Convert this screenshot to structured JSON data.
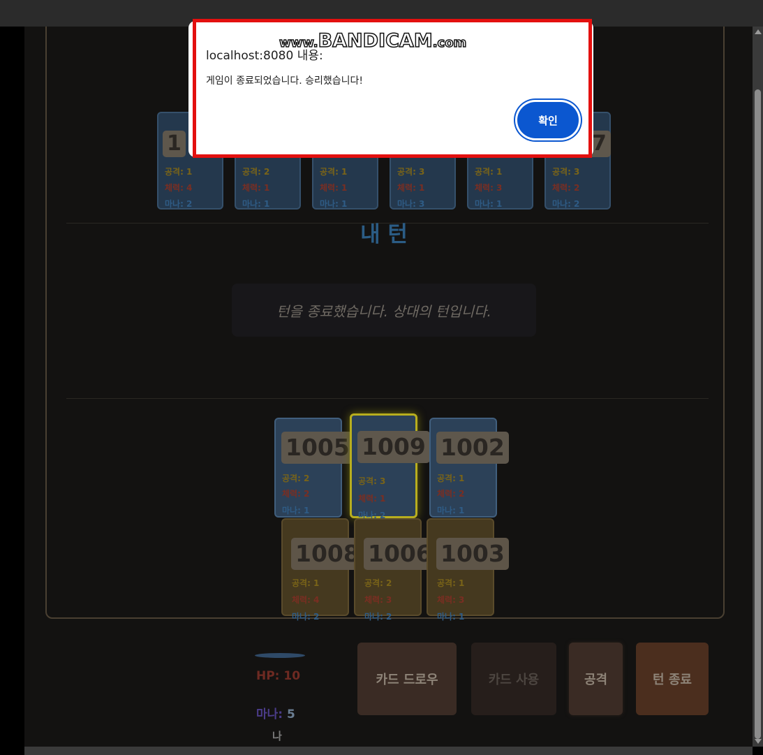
{
  "dialog": {
    "title": "localhost:8080 내용:",
    "message": "게임이 종료되었습니다. 승리했습니다!",
    "ok_label": "확인"
  },
  "watermark": {
    "pre": "www.",
    "main": "BANDICAM",
    "post": ".com"
  },
  "enemy_cards": [
    {
      "id": "1",
      "attack": "공격: 1",
      "health": "체력: 4",
      "mana": "마나: 2"
    },
    {
      "id": "",
      "attack": "공격: 2",
      "health": "체력: 1",
      "mana": "마나: 1"
    },
    {
      "id": "",
      "attack": "공격: 1",
      "health": "체력: 1",
      "mana": "마나: 1"
    },
    {
      "id": "",
      "attack": "공격: 3",
      "health": "체력: 1",
      "mana": "마나: 3"
    },
    {
      "id": "",
      "attack": "공격: 1",
      "health": "체력: 3",
      "mana": "마나: 1"
    },
    {
      "id": "7",
      "attack": "공격: 3",
      "health": "체력: 2",
      "mana": "마나: 2"
    }
  ],
  "turn_title": "내 턴",
  "message": "턴을 종료했습니다. 상대의 턴입니다.",
  "field_cards": [
    {
      "id": "1005",
      "attack": "공격: 2",
      "health": "체력: 2",
      "mana": "마나: 1"
    },
    {
      "id": "1009",
      "attack": "공격: 3",
      "health": "체력: 1",
      "mana": "마나: 2"
    },
    {
      "id": "1002",
      "attack": "공격: 1",
      "health": "체력: 2",
      "mana": "마나: 1"
    }
  ],
  "hand_cards": [
    {
      "id": "1008",
      "attack": "공격: 1",
      "health": "체력: 4",
      "mana": "마나: 2"
    },
    {
      "id": "1006",
      "attack": "공격: 2",
      "health": "체력: 3",
      "mana": "마나: 2"
    },
    {
      "id": "1003",
      "attack": "공격: 1",
      "health": "체력: 3",
      "mana": "마나: 1"
    }
  ],
  "player": {
    "hp": "HP: 10",
    "mana_label": "마나:",
    "mana_value": "5",
    "name": "나"
  },
  "actions": {
    "draw": "카드 드로우",
    "use": "카드 사용",
    "attack": "공격",
    "end_turn": "턴 종료"
  }
}
